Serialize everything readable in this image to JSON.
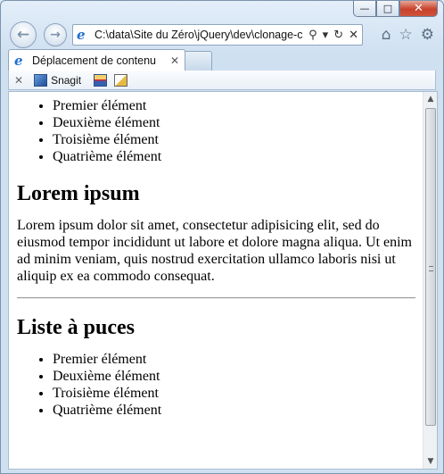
{
  "browser": {
    "address_url": "C:\\data\\Site du Zéro\\jQuery\\dev\\clonage-c",
    "tab_title": "Déplacement de contenu",
    "caption": {
      "minimize": "—",
      "maximize": "□",
      "close": "✕"
    },
    "nav": {
      "back_icon": "←",
      "forward_icon": "→"
    },
    "address_tools": {
      "search": "⚲",
      "dropdown": "▾",
      "refresh": "↻",
      "stop": "✕"
    },
    "right_icons": {
      "home": "⌂",
      "favorites": "☆",
      "tools": "⚙"
    },
    "tab_close": "✕",
    "command_bar": {
      "close": "✕",
      "snagit_label": "Snagit"
    }
  },
  "page": {
    "list1": [
      "Premier élément",
      "Deuxième élément",
      "Troisième élément",
      "Quatrième élément"
    ],
    "heading1": "Lorem ipsum",
    "paragraph": "Lorem ipsum dolor sit amet, consectetur adipisicing elit, sed do eiusmod tempor incididunt ut labore et dolore magna aliqua. Ut enim ad minim veniam, quis nostrud exercitation ullamco laboris nisi ut aliquip ex ea commodo consequat.",
    "heading2": "Liste à puces",
    "list2": [
      "Premier élément",
      "Deuxième élément",
      "Troisième élément",
      "Quatrième élément"
    ]
  },
  "scrollbar": {
    "up": "▲",
    "down": "▼"
  }
}
